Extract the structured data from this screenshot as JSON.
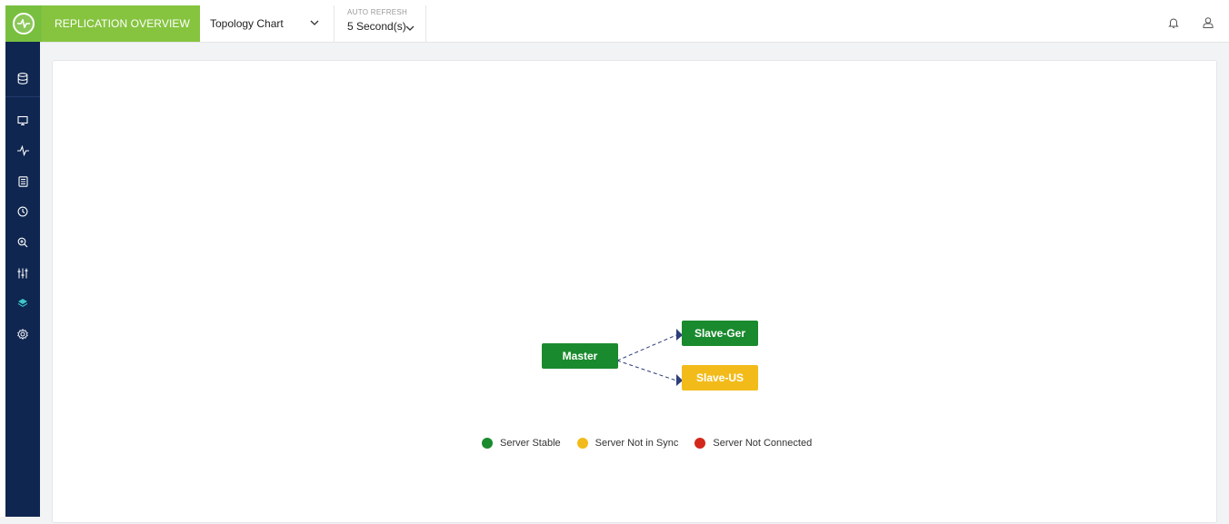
{
  "header": {
    "title": "REPLICATION OVERVIEW",
    "view_select": {
      "value": "Topology Chart"
    },
    "auto_refresh": {
      "label": "AUTO REFRESH",
      "value": "5 Second(s)"
    },
    "icons": [
      "bell-icon",
      "user-icon"
    ]
  },
  "sidebar": {
    "items": [
      {
        "icon": "database-icon",
        "active": false
      },
      {
        "icon": "monitor-icon",
        "active": false
      },
      {
        "icon": "pulse-icon",
        "active": false
      },
      {
        "icon": "document-icon",
        "active": false
      },
      {
        "icon": "clock-icon",
        "active": false
      },
      {
        "icon": "zoom-icon",
        "active": false
      },
      {
        "icon": "sliders-icon",
        "active": false
      },
      {
        "icon": "layers-icon",
        "active": true
      },
      {
        "icon": "gear-icon",
        "active": false
      }
    ]
  },
  "topology": {
    "nodes": [
      {
        "id": "master",
        "label": "Master",
        "status": "stable"
      },
      {
        "id": "slave-ger",
        "label": "Slave-Ger",
        "status": "stable"
      },
      {
        "id": "slave-us",
        "label": "Slave-US",
        "status": "not-in-sync"
      }
    ],
    "links": [
      {
        "from": "master",
        "to": "slave-ger"
      },
      {
        "from": "master",
        "to": "slave-us"
      }
    ],
    "legend": [
      {
        "label": "Server Stable",
        "color": "#1a8a2e"
      },
      {
        "label": "Server Not in Sync",
        "color": "#f2bb1a"
      },
      {
        "label": "Server Not Connected",
        "color": "#d3271b"
      }
    ]
  },
  "colors": {
    "accent_green": "#86c440",
    "sidebar_bg": "#0f2650",
    "active_icon": "#3fc7c7",
    "stable": "#1a8a2e",
    "not_in_sync": "#f2bb1a",
    "not_connected": "#d3271b"
  }
}
